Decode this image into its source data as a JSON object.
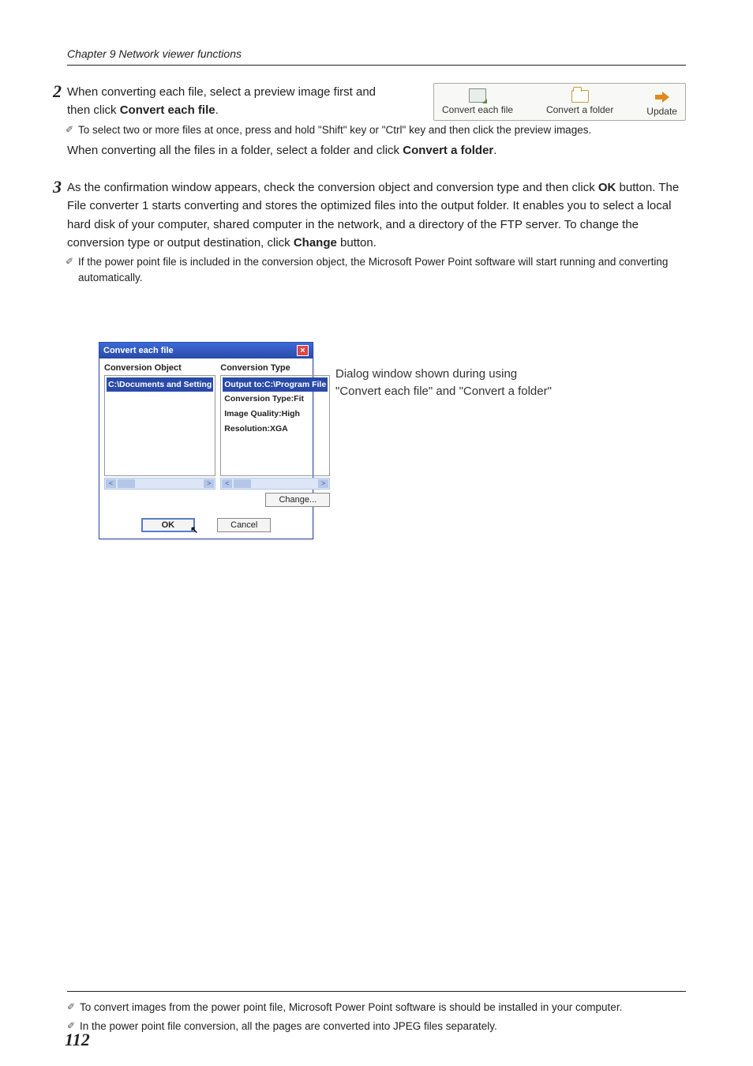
{
  "chapter_header": "Chapter 9 Network viewer functions",
  "step2": {
    "num": "2",
    "line1_a": "When converting each file, select a preview image first and then click ",
    "line1_b": "Convert each file",
    "line1_c": ".",
    "note": "To select two or more files at once, press and hold \"Shift\" key or \"Ctrl\" key and then click the preview images.",
    "line2_a": "When converting all the files in a folder, select a folder and click ",
    "line2_b": "Convert a folder",
    "line2_c": "."
  },
  "toolbar": {
    "btn1": "Convert each file",
    "btn2": "Convert a folder",
    "btn3": "Update"
  },
  "step3": {
    "num": "3",
    "p1_a": "As the confirmation window appears, check the conversion object and conversion type and then click ",
    "p1_b": "OK",
    "p1_c": " button. The File converter 1 starts converting and stores the optimized files into the output folder. It enables you to select a local hard disk of your computer, shared computer in the network, and a directory of the FTP server. To change the conversion type or output destination, click ",
    "p1_d": "Change",
    "p1_e": " button.",
    "note": "If the power point file is included in the conversion object, the Microsoft Power Point software will start running and converting automatically."
  },
  "dialog": {
    "title": "Convert each file",
    "col1_head": "Conversion Object",
    "col1_row": "C:\\Documents and Setting",
    "col2_head": "Conversion Type",
    "col2_r1": "Output to:C:\\Program File",
    "col2_r2": "Conversion Type:Fit",
    "col2_r3": "Image Quality:High",
    "col2_r4": "Resolution:XGA",
    "change": "Change...",
    "ok": "OK",
    "cancel": "Cancel"
  },
  "dialog_caption_l1": "Dialog window shown during using",
  "dialog_caption_l2": "\"Convert each file\" and \"Convert a folder\"",
  "foot1": "To convert images from the power point file, Microsoft Power Point software is should be installed in your computer.",
  "foot2": "In the power point file conversion, all the pages are converted into JPEG files separately.",
  "page_num": "112"
}
